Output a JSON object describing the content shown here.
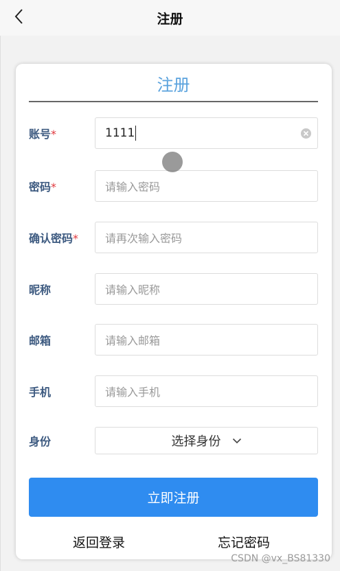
{
  "nav": {
    "title": "注册"
  },
  "card": {
    "title": "注册"
  },
  "form": {
    "account": {
      "label": "账号",
      "required_mark": "*",
      "value": "1111"
    },
    "password": {
      "label": "密码",
      "required_mark": "*",
      "placeholder": "请输入密码"
    },
    "confirm_password": {
      "label": "确认密码",
      "required_mark": "*",
      "placeholder": "请再次输入密码"
    },
    "nickname": {
      "label": "昵称",
      "placeholder": "请输入昵称"
    },
    "email": {
      "label": "邮箱",
      "placeholder": "请输入邮箱"
    },
    "phone": {
      "label": "手机",
      "placeholder": "请输入手机"
    },
    "identity": {
      "label": "身份",
      "selected": "选择身份"
    }
  },
  "actions": {
    "submit_label": "立即注册",
    "back_to_login": "返回登录",
    "forgot_password": "忘记密码"
  },
  "watermark": "CSDN @vx_BS81330",
  "colors": {
    "accent": "#2f8cf0",
    "title_blue": "#5aa2dd",
    "label": "#3d5a80",
    "required": "#e0383e"
  },
  "icons": [
    "back-icon",
    "clear-icon",
    "chevron-down-icon"
  ]
}
